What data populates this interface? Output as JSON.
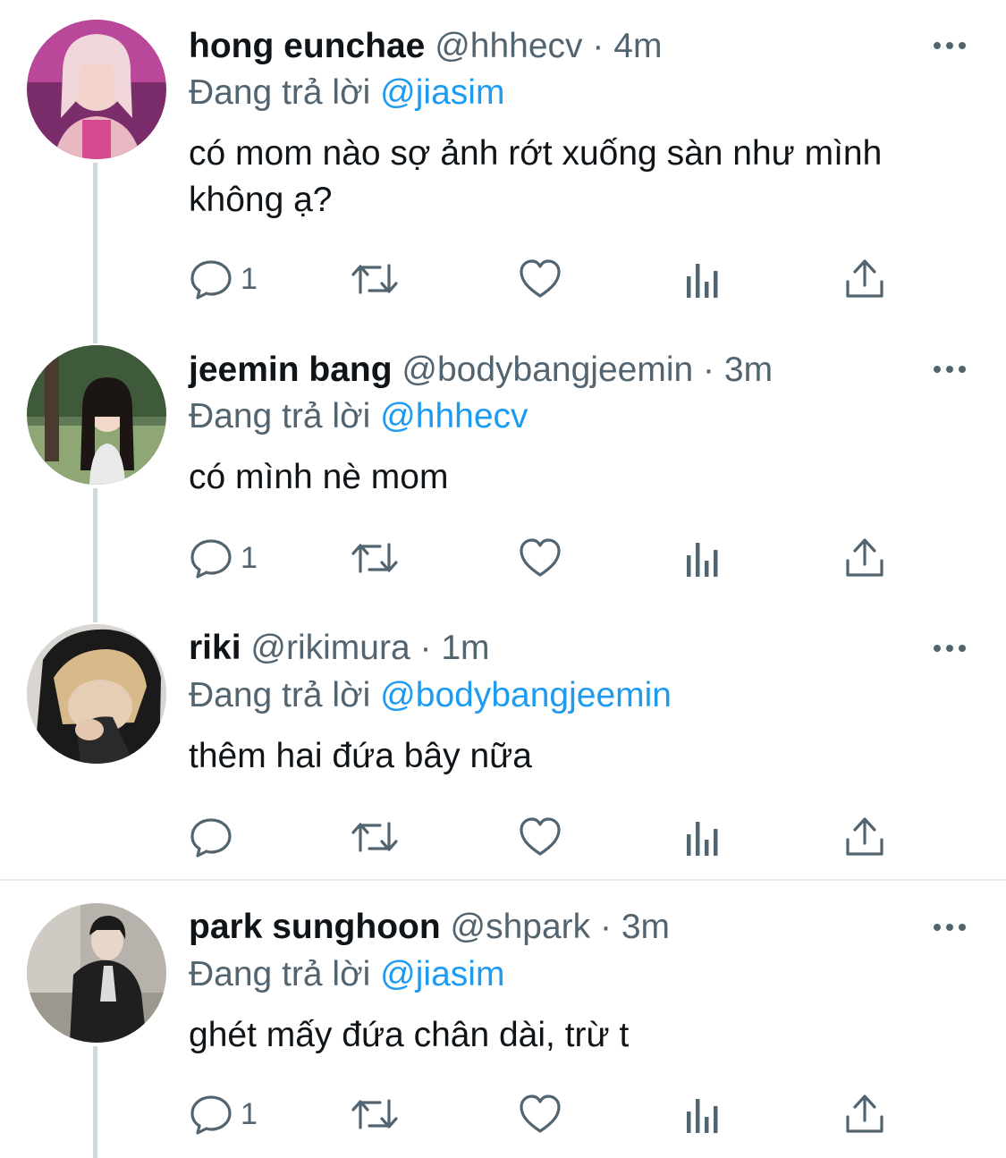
{
  "colors": {
    "name": "#0f1419",
    "meta": "#536471",
    "mention": "#1d9bf0",
    "thread_line": "#cfd9de",
    "divider": "#e6ecf0"
  },
  "reply_prefix": "Đang trả lời",
  "tweets": [
    {
      "display_name": "hong eunchae",
      "handle": "@hhhecv",
      "time": "4m",
      "reply_to": "@jiasim",
      "text": "có mom nào sợ ảnh rớt xuống sàn như mình không ạ?",
      "reply_count": "1",
      "avatar_icon": "profile-photo-pink"
    },
    {
      "display_name": "jeemin bang",
      "handle": "@bodybangjeemin",
      "time": "3m",
      "reply_to": "@hhhecv",
      "text": "có mình nè mom",
      "reply_count": "1",
      "avatar_icon": "profile-photo-park"
    },
    {
      "display_name": "riki",
      "handle": "@rikimura",
      "time": "1m",
      "reply_to": "@bodybangjeemin",
      "text": "thêm hai đứa bây nữa",
      "reply_count": "",
      "avatar_icon": "profile-photo-hood"
    },
    {
      "display_name": "park sunghoon",
      "handle": "@shpark",
      "time": "3m",
      "reply_to": "@jiasim",
      "text": "ghét mấy đứa chân dài, trừ t",
      "reply_count": "1",
      "avatar_icon": "profile-photo-couch"
    }
  ]
}
